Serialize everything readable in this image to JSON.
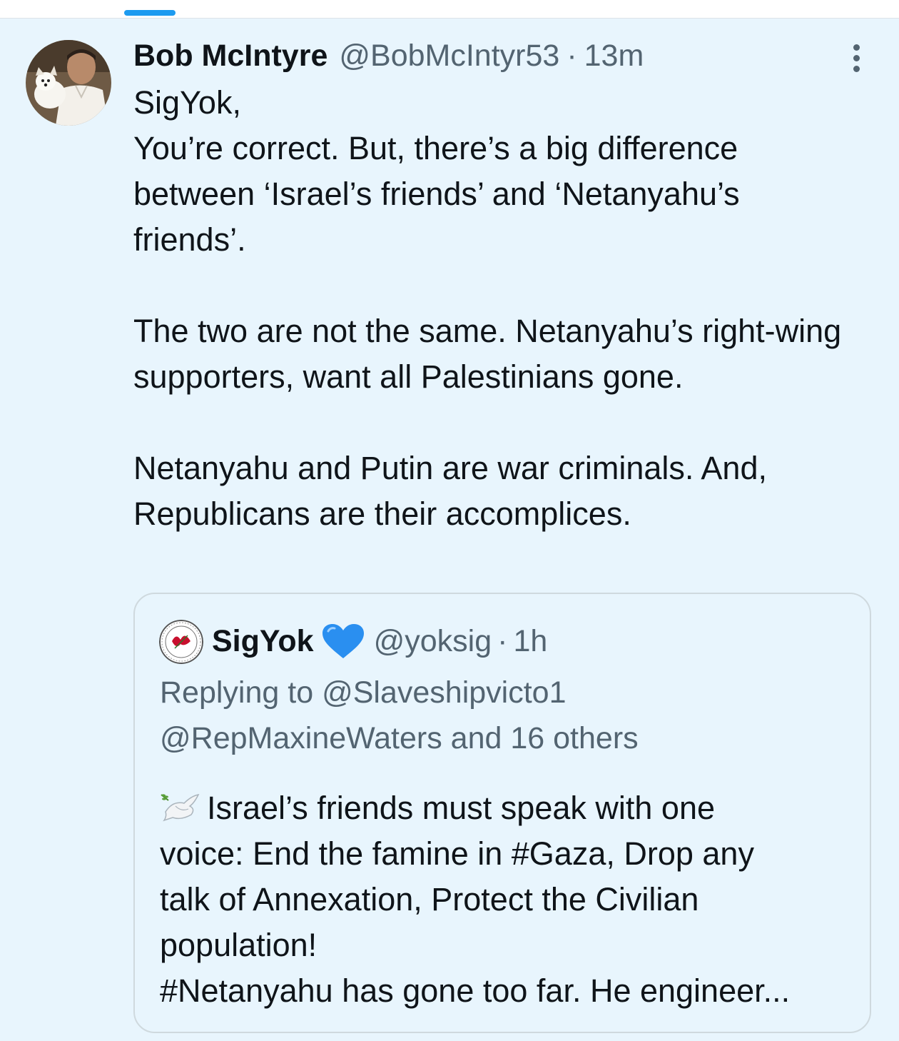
{
  "tweet": {
    "author_name": "Bob McIntyre",
    "handle": "@BobMcIntyr53",
    "separator": "·",
    "time": "13m",
    "paragraphs": [
      "SigYok,\nYou’re correct. But, there’s a big difference between ‘Israel’s friends’ and ‘Netanyahu’s friends’.",
      "The two are not the same. Netanyahu’s right-wing supporters, want all Palestinians gone.",
      "Netanyahu and Putin are war criminals. And, Republicans are their accomplices."
    ]
  },
  "quoted": {
    "author_name": "SigYok",
    "handle": "@yoksig",
    "separator": "·",
    "time": "1h",
    "replying_to_lines": [
      "Replying to @Slaveshipvicto1",
      "@RepMaxineWaters and 16 others"
    ],
    "text_lines": [
      "Israel’s friends must speak with one",
      "voice: End the famine in #Gaza, Drop any",
      "talk of Annexation, Protect the Civilian",
      "population!",
      "#Netanyahu has gone too far. He engineer..."
    ]
  },
  "icons": {
    "more": "more-vertical-icon",
    "heart": "blue-heart-icon",
    "dove": "dove-of-peace-icon"
  },
  "colors": {
    "tweet_background": "#e8f5fd",
    "accent": "#1d9bf0",
    "muted_text": "#536471",
    "card_border": "#cfd9de"
  }
}
